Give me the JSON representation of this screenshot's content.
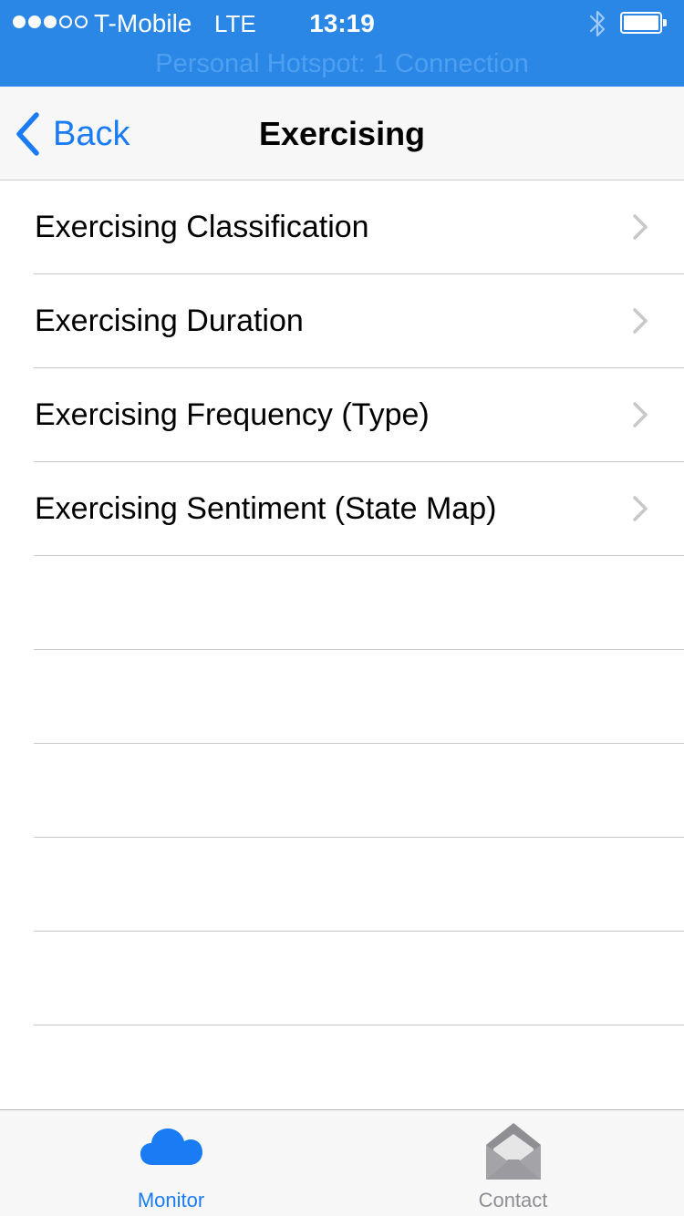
{
  "status_bar": {
    "signal_dots_filled": 3,
    "signal_dots_total": 5,
    "carrier": "T-Mobile",
    "network": "LTE",
    "time": "13:19",
    "bluetooth_icon": "bluetooth-icon",
    "battery_icon": "battery-icon",
    "battery_level": 1.0
  },
  "hotspot_banner": {
    "text": "Personal Hotspot: 1 Connection"
  },
  "nav": {
    "back_label": "Back",
    "back_icon": "chevron-left-icon",
    "title": "Exercising"
  },
  "table": {
    "items": [
      {
        "label": "Exercising Classification",
        "icon": "chevron-right-icon"
      },
      {
        "label": "Exercising Duration",
        "icon": "chevron-right-icon"
      },
      {
        "label": "Exercising Frequency (Type)",
        "icon": "chevron-right-icon"
      },
      {
        "label": "Exercising Sentiment (State Map)",
        "icon": "chevron-right-icon"
      }
    ],
    "empty_rows": 6
  },
  "tab_bar": {
    "tabs": [
      {
        "label": "Monitor",
        "icon": "cloud-icon",
        "selected": true
      },
      {
        "label": "Contact",
        "icon": "envelope-icon",
        "selected": false
      }
    ]
  },
  "colors": {
    "status_bar_bg": "#2a87e6",
    "accent": "#1a7cf5",
    "nav_bg": "#f7f7f7",
    "separator": "#c8c7cc",
    "tab_inactive": "#8e8e93",
    "hotspot_text": "#4f9ff0"
  }
}
